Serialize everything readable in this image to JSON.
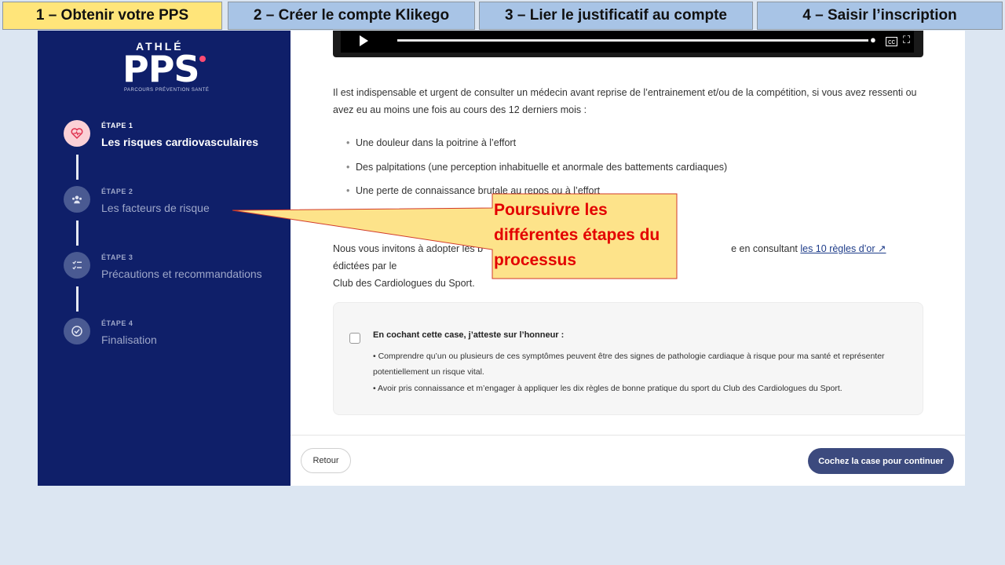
{
  "tabs": [
    {
      "label": "1 – Obtenir votre PPS",
      "color": "#ffe57a"
    },
    {
      "label": "2 – Créer le compte Klikego",
      "color": "#a8c4e6"
    },
    {
      "label": "3 – Lier le justificatif au compte",
      "color": "#a8c4e6"
    },
    {
      "label": "4 – Saisir l’inscription",
      "color": "#a8c4e6"
    }
  ],
  "sidebar": {
    "logo": {
      "brand": "ATHLÉ",
      "name": "PPS",
      "tagline": "PARCOURS PRÉVENTION SANTÉ"
    },
    "steps": [
      {
        "label": "ÉTAPE 1",
        "title": "Les risques cardiovasculaires",
        "icon": "heart-icon",
        "active": true
      },
      {
        "label": "ÉTAPE 2",
        "title": "Les facteurs de risque",
        "icon": "group-icon",
        "active": false
      },
      {
        "label": "ÉTAPE 3",
        "title": "Précautions et recommandations",
        "icon": "checklist-icon",
        "active": false
      },
      {
        "label": "ÉTAPE 4",
        "title": "Finalisation",
        "icon": "check-circle-icon",
        "active": false
      }
    ]
  },
  "content": {
    "intro": "Il est indispensable et urgent de consulter un médecin avant reprise de l’entrainement et/ou de la compétition, si vous avez ressenti ou avez eu au moins une fois au cours des 12 derniers mois :",
    "bullets": [
      "Une douleur dans la poitrine à l’effort",
      "Des palpitations (une perception inhabituelle et anormale des battements cardiaques)",
      "Une perte de connaissance brutale au repos ou à l’effort"
    ],
    "invite_start": "Nous vous invitons à adopter les b",
    "invite_mid": "e en consultant ",
    "invite_link": "les 10 règles d’or ↗",
    "invite_end": " édictées par le",
    "invite_line2": "Club des Cardiologues du Sport.",
    "attest_title": "En cochant cette case, j’atteste sur l’honneur :",
    "attest_items": [
      "• Comprendre qu’un ou plusieurs de ces symptômes peuvent être des signes de pathologie cardiaque à risque pour ma santé et représenter potentiellement un risque vital.",
      "• Avoir pris connaissance et m’engager à appliquer les dix règles de bonne pratique du sport du Club des Cardiologues du Sport."
    ]
  },
  "footer": {
    "back": "Retour",
    "next": "Cochez la case pour continuer"
  },
  "callout": {
    "text": "Poursuivre les différentes étapes du processus"
  }
}
